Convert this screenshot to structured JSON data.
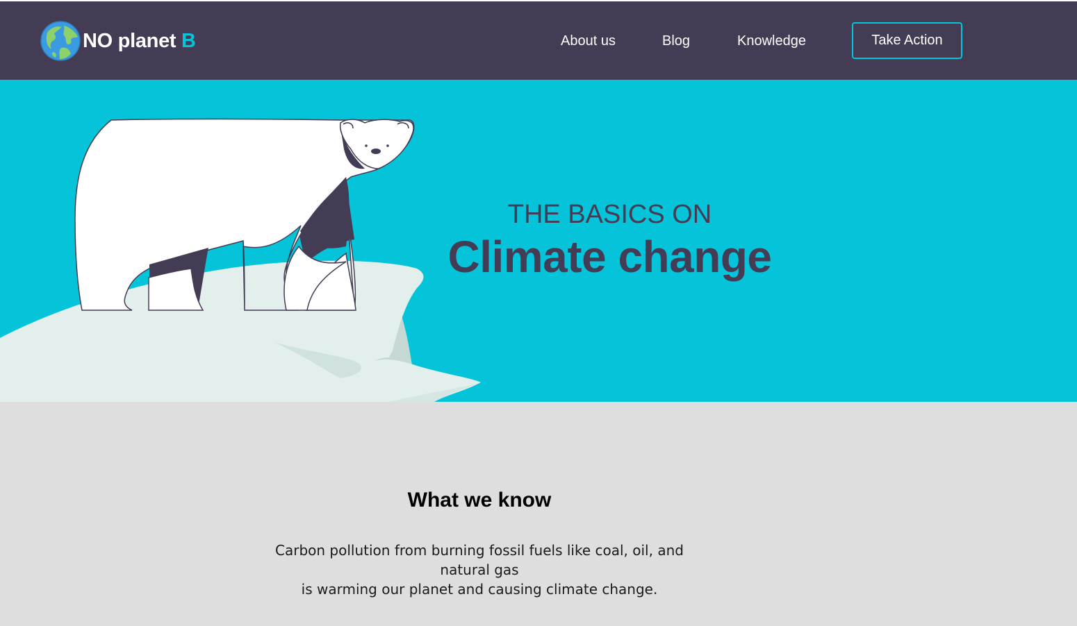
{
  "brand": {
    "name_main": "NO planet",
    "name_accent": "B",
    "logo_icon": "earth-globe-icon",
    "colors": {
      "nav_bg": "#433c54",
      "accent": "#05c3d8",
      "section_bg": "#dededf",
      "hero_bg": "#05c3d8"
    }
  },
  "nav": {
    "items": [
      {
        "label": "About us"
      },
      {
        "label": "Blog"
      },
      {
        "label": "Knowledge"
      }
    ],
    "cta_label": "Take Action"
  },
  "hero": {
    "kicker": "THE BASICS ON",
    "title": "Climate change",
    "illustration": "polar-bear-on-ice-floe"
  },
  "info": {
    "title": "What we know",
    "body_line1": "Carbon pollution from burning fossil fuels like coal, oil, and natural gas",
    "body_line2": "is warming our planet and causing climate change."
  }
}
